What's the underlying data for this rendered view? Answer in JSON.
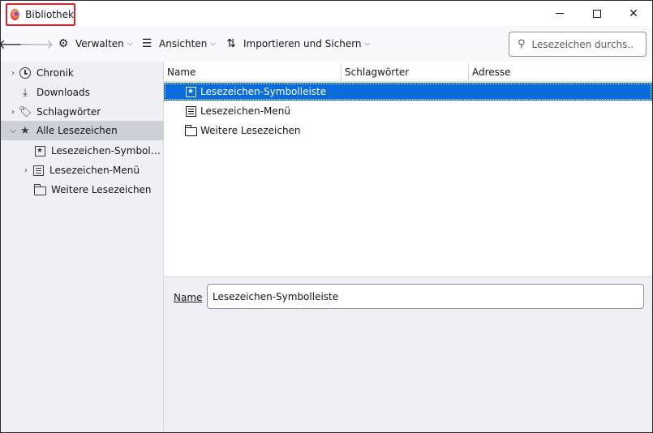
{
  "window": {
    "title": "Bibliothek",
    "controls": {
      "minimize": "",
      "maximize": "",
      "close": "✕"
    }
  },
  "toolbar": {
    "back_icon": "arrow-left-icon",
    "forward_icon": "arrow-right-icon",
    "manage_label": "Verwalten",
    "views_label": "Ansichten",
    "import_label": "Importieren und Sichern"
  },
  "search": {
    "placeholder": "Lesezeichen durchs...",
    "value": ""
  },
  "sidebar": {
    "items": [
      {
        "label": "Chronik",
        "icon": "clock-icon"
      },
      {
        "label": "Downloads",
        "icon": "download-icon"
      },
      {
        "label": "Schlagwörter",
        "icon": "tag-icon"
      },
      {
        "label": "Alle Lesezeichen",
        "icon": "star-icon",
        "selected": true
      },
      {
        "label": "Lesezeichen-Symbolleiste",
        "icon": "bookmark-toolbar-icon"
      },
      {
        "label": "Lesezeichen-Menü",
        "icon": "bookmark-menu-icon"
      },
      {
        "label": "Weitere Lesezeichen",
        "icon": "folder-icon"
      }
    ]
  },
  "list": {
    "columns": [
      "Name",
      "Schlagwörter",
      "Adresse"
    ],
    "rows": [
      {
        "name": "Lesezeichen-Symbolleiste",
        "icon": "bookmark-toolbar-icon",
        "selected": true
      },
      {
        "name": "Lesezeichen-Menü",
        "icon": "bookmark-menu-icon"
      },
      {
        "name": "Weitere Lesezeichen",
        "icon": "folder-icon"
      }
    ]
  },
  "details": {
    "name_label": "Name",
    "name_value": "Lesezeichen-Symbolleiste"
  },
  "colors": {
    "selection": "#0a6cdc",
    "highlight_box": "#e0202a",
    "sidebar_selected": "#cfcfd8"
  }
}
